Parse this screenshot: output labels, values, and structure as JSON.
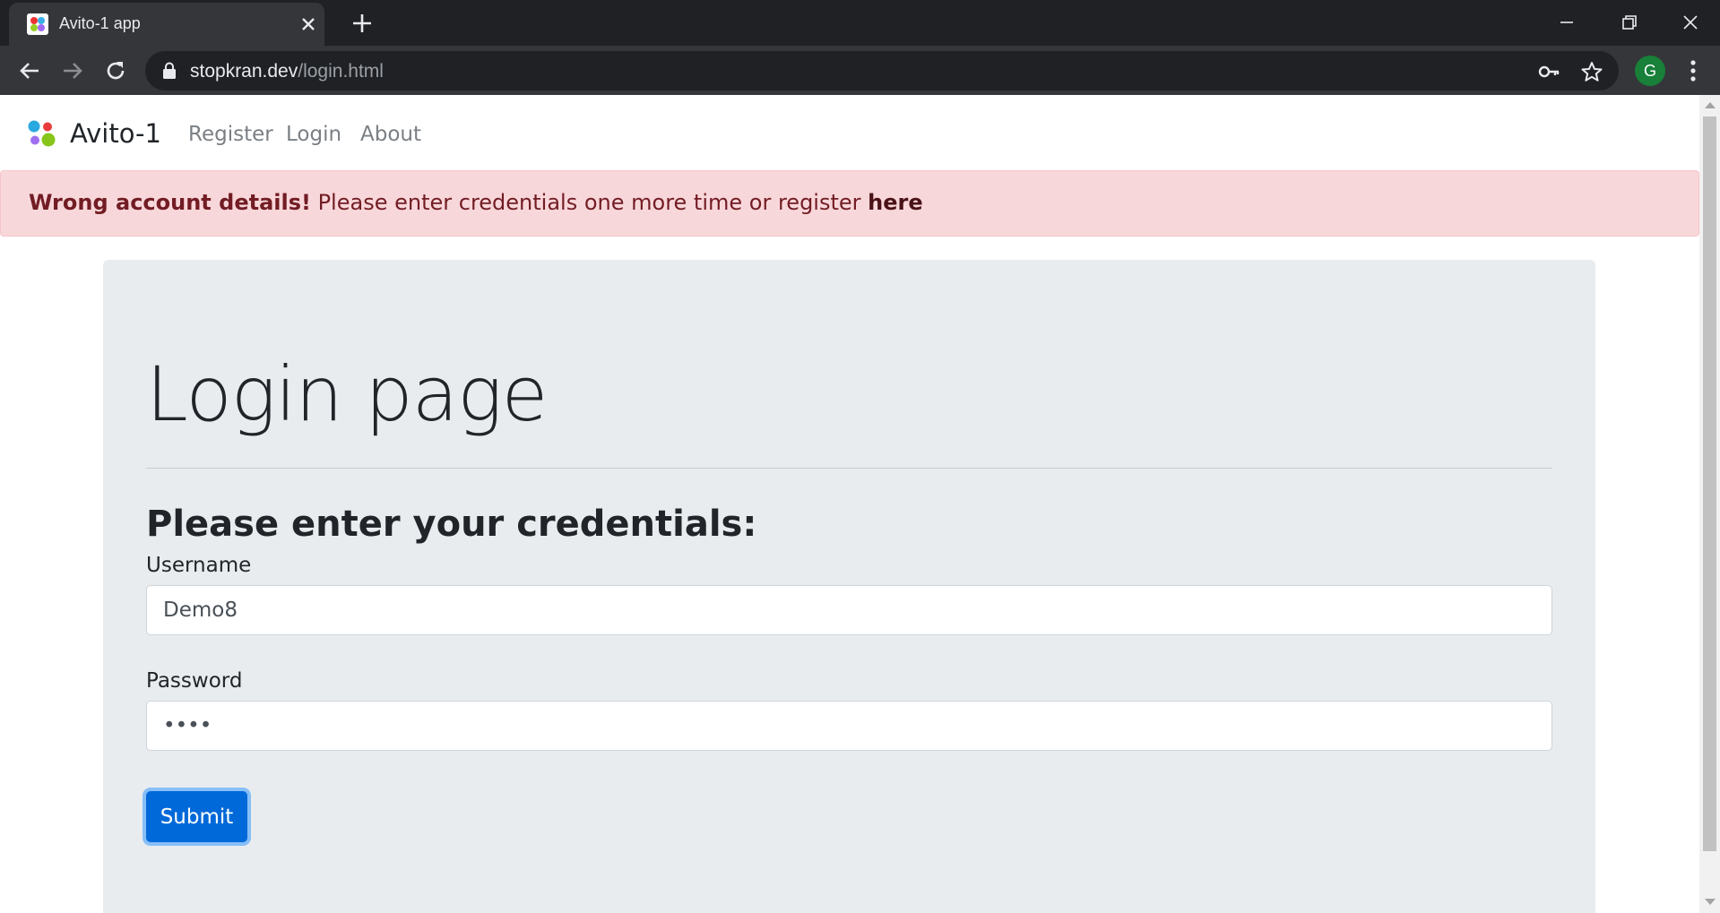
{
  "browser": {
    "tab_title": "Avito-1 app",
    "url_host": "stopkran.dev",
    "url_path": "/login.html",
    "profile_initial": "G"
  },
  "navbar": {
    "brand": "Avito-1",
    "links": [
      "Register",
      "Login",
      "About"
    ]
  },
  "alert": {
    "strong": "Wrong account details!",
    "message": " Please enter credentials one more time or register ",
    "link": "here",
    "background": "#f8d7da",
    "text_color": "#721c24"
  },
  "main": {
    "title": "Login page",
    "subtitle": "Please enter your credentials:",
    "username_label": "Username",
    "username_value": "Demo8",
    "password_label": "Password",
    "password_value": "••••",
    "submit_label": "Submit"
  },
  "colors": {
    "primary": "#0069d9",
    "jumbotron": "#e9ecef"
  }
}
